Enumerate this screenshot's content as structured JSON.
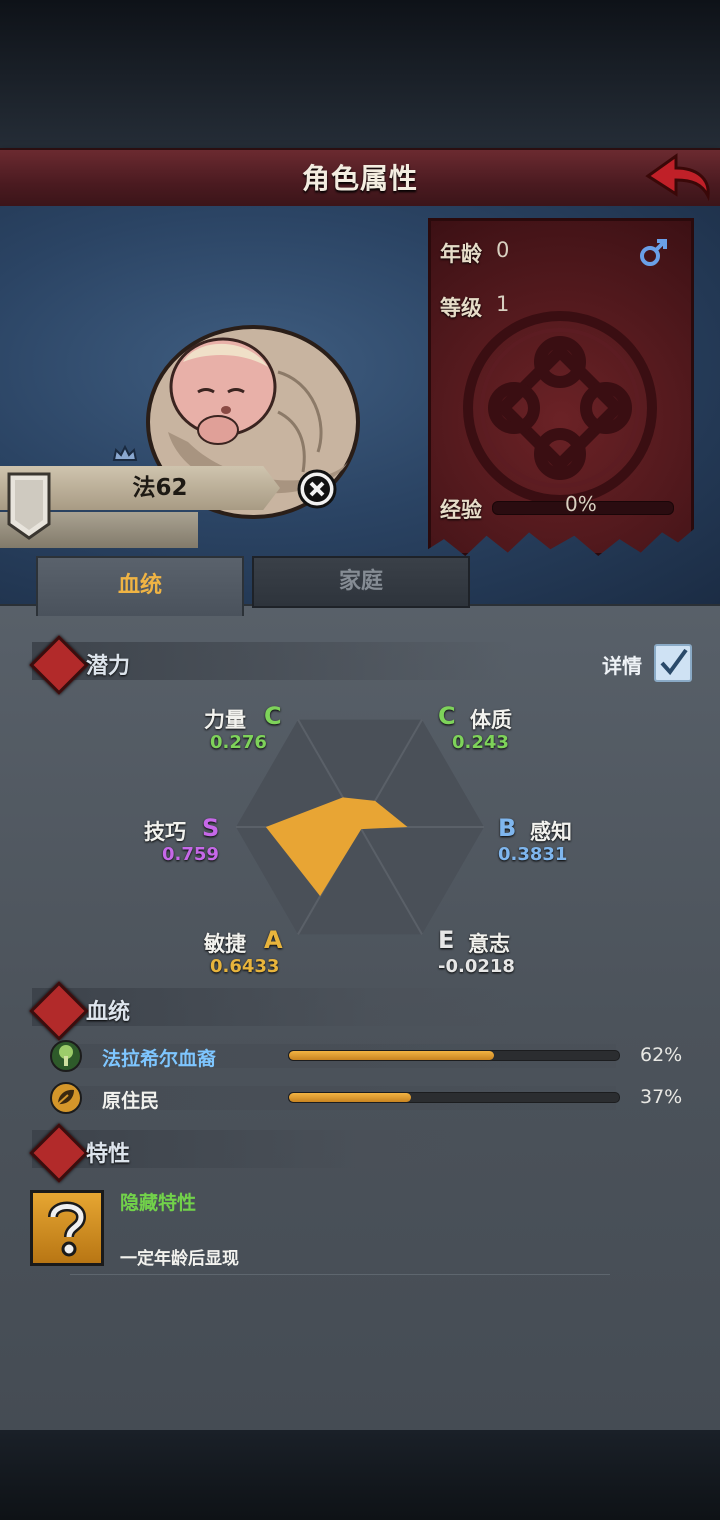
{
  "header": {
    "title": "角色属性"
  },
  "character": {
    "name": "法62",
    "age_label": "年龄",
    "age_value": "0",
    "level_label": "等级",
    "level_value": "1",
    "exp_label": "经验",
    "exp_value": "0%",
    "exp_fraction": 0,
    "gender_icon": "male-icon"
  },
  "tabs": [
    {
      "label": "血统",
      "active": true
    },
    {
      "label": "家庭",
      "active": false
    }
  ],
  "potential": {
    "title": "潜力",
    "details_label": "详情",
    "details_checked": true,
    "stats": [
      {
        "name": "力量",
        "grade": "C",
        "value": "0.276",
        "grade_color": "#7ed35a",
        "value_color": "#7ed35a"
      },
      {
        "name": "体质",
        "grade": "C",
        "value": "0.243",
        "grade_color": "#7ed35a",
        "value_color": "#7ed35a"
      },
      {
        "name": "感知",
        "grade": "B",
        "value": "0.3831",
        "grade_color": "#7fb6ee",
        "value_color": "#7fb6ee"
      },
      {
        "name": "意志",
        "grade": "E",
        "value": "-0.0218",
        "grade_color": "#e6e6e6",
        "value_color": "#e6e6e6"
      },
      {
        "name": "敏捷",
        "grade": "A",
        "value": "0.6433",
        "grade_color": "#e8b43c",
        "value_color": "#e8b43c"
      },
      {
        "name": "技巧",
        "grade": "S",
        "value": "0.759",
        "grade_color": "#c668e8",
        "value_color": "#c668e8"
      }
    ]
  },
  "bloodline": {
    "title": "血统",
    "items": [
      {
        "name": "法拉希尔血裔",
        "percent": "62%",
        "fraction": 0.62,
        "name_color": "#7ec6ff",
        "icon": "tree-icon"
      },
      {
        "name": "原住民",
        "percent": "37%",
        "fraction": 0.37,
        "name_color": "#f2f2ee",
        "icon": "leaf-icon"
      }
    ]
  },
  "traits": {
    "title": "特性",
    "items": [
      {
        "name": "隐藏特性",
        "description": "一定年龄后显现",
        "icon": "question-icon"
      }
    ]
  },
  "colors": {
    "radar_fill": "#e8a534",
    "accent_red": "#b22a2a",
    "banner": "#5a2026"
  }
}
